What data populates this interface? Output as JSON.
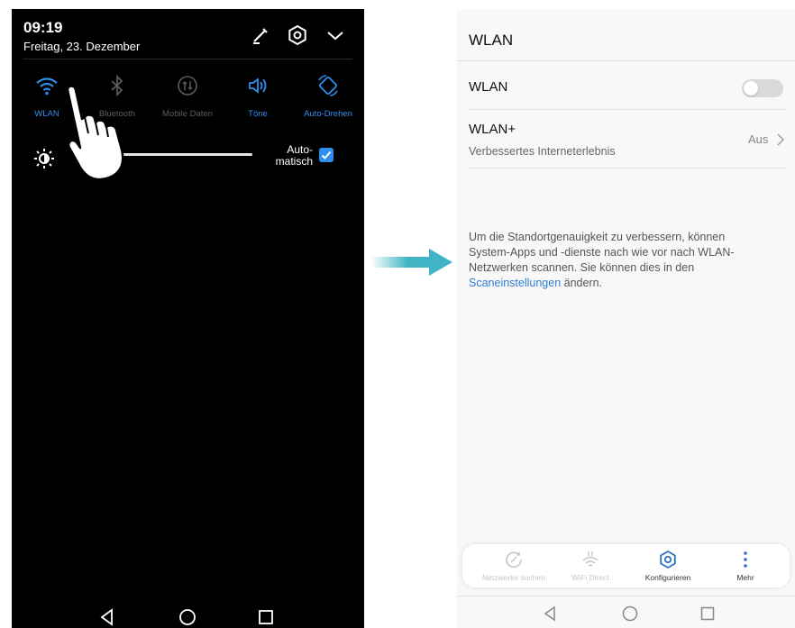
{
  "left_screen": {
    "status": {
      "time": "09:19",
      "date": "Freitag, 23. Dezember"
    },
    "header_icons": [
      "edit-icon",
      "settings-icon",
      "collapse-chevron-icon"
    ],
    "tiles": [
      {
        "label": "WLAN",
        "icon": "wifi-icon",
        "active": true
      },
      {
        "label": "Bluetooth",
        "icon": "bluetooth-icon",
        "active": false
      },
      {
        "label": "Mobile Daten",
        "icon": "mobile-data-icon",
        "active": false
      },
      {
        "label": "Töne",
        "icon": "sound-icon",
        "active": true
      },
      {
        "label": "Auto-Drehen",
        "icon": "auto-rotate-icon",
        "active": true
      }
    ],
    "brightness": {
      "auto_label_line1": "Auto-",
      "auto_label_line2": "matisch",
      "auto_checked": true
    },
    "navbar": [
      "back-icon",
      "home-icon",
      "recents-icon"
    ]
  },
  "right_screen": {
    "title": "WLAN",
    "rows": {
      "wlan": {
        "label": "WLAN",
        "toggle_on": false
      },
      "wlan_plus": {
        "label": "WLAN+",
        "subtitle": "Verbessertes Interneterlebnis",
        "value": "Aus"
      }
    },
    "info": {
      "line1": "Um die Standortgenauigkeit zu verbessern, können",
      "line2": "System-Apps und -dienste nach wie vor nach WLAN-",
      "line3": "Netzwerken scannen. Sie können dies in den",
      "link": "Scaneinstellungen",
      "after_link": " ändern."
    },
    "bottom_bar": [
      {
        "label": "Netzwerke suchen",
        "icon": "refresh-icon",
        "enabled": false
      },
      {
        "label": "WiFi Direct",
        "icon": "wifi-direct-icon",
        "enabled": false
      },
      {
        "label": "Konfigurieren",
        "icon": "settings-icon",
        "enabled": true
      },
      {
        "label": "Mehr",
        "icon": "more-icon",
        "enabled": true
      }
    ],
    "navbar": [
      "back-icon",
      "home-icon",
      "recents-icon"
    ]
  },
  "colors": {
    "accent": "#2d8ff0",
    "arrow": "#3fb4c4",
    "left_bg": "#000000",
    "right_bg": "#f8f8f8"
  }
}
